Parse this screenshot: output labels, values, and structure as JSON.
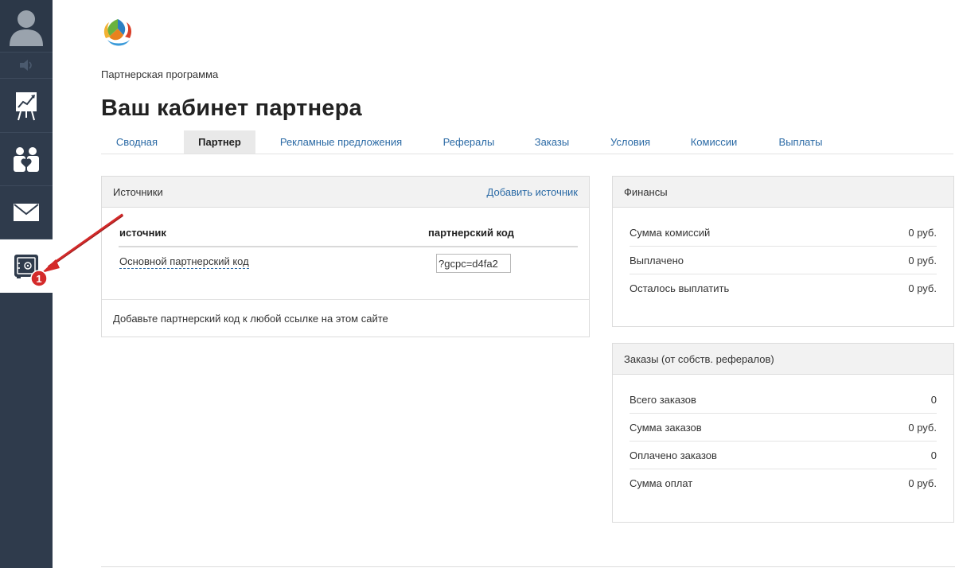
{
  "sidebar": {
    "items": [
      {
        "name": "avatar"
      },
      {
        "name": "sound"
      },
      {
        "name": "chart"
      },
      {
        "name": "users"
      },
      {
        "name": "mail"
      },
      {
        "name": "safe"
      }
    ]
  },
  "breadcrumb": "Партнерская программа",
  "page_title": "Ваш кабинет партнера",
  "tabs": [
    {
      "label": "Сводная",
      "active": false
    },
    {
      "label": "Партнер",
      "active": true
    },
    {
      "label": "Рекламные предложения",
      "active": false
    },
    {
      "label": "Рефералы",
      "active": false
    },
    {
      "label": "Заказы",
      "active": false
    },
    {
      "label": "Условия",
      "active": false
    },
    {
      "label": "Комиссии",
      "active": false
    },
    {
      "label": "Выплаты",
      "active": false
    }
  ],
  "sources": {
    "title": "Источники",
    "add_link": "Добавить источник",
    "columns": [
      "источник",
      "партнерский код"
    ],
    "rows": [
      {
        "source": "Основной партнерский код",
        "code": "?gcpc=d4fa2"
      }
    ],
    "hint": "Добавьте партнерский код к любой ссылке на этом сайте"
  },
  "finances": {
    "title": "Финансы",
    "rows": [
      {
        "label": "Сумма комиссий",
        "value": "0 руб."
      },
      {
        "label": "Выплачено",
        "value": "0 руб."
      },
      {
        "label": "Осталось выплатить",
        "value": "0 руб."
      }
    ]
  },
  "orders": {
    "title": "Заказы (от собств. рефералов)",
    "rows": [
      {
        "label": "Всего заказов",
        "value": "0"
      },
      {
        "label": "Сумма заказов",
        "value": "0 руб."
      },
      {
        "label": "Оплачено заказов",
        "value": "0"
      },
      {
        "label": "Сумма оплат",
        "value": "0 руб."
      }
    ]
  },
  "annotation": {
    "number": "1"
  },
  "colors": {
    "sidebar": "#2f3b4c",
    "link": "#2b6aa5",
    "annotation": "#d42a2a"
  }
}
